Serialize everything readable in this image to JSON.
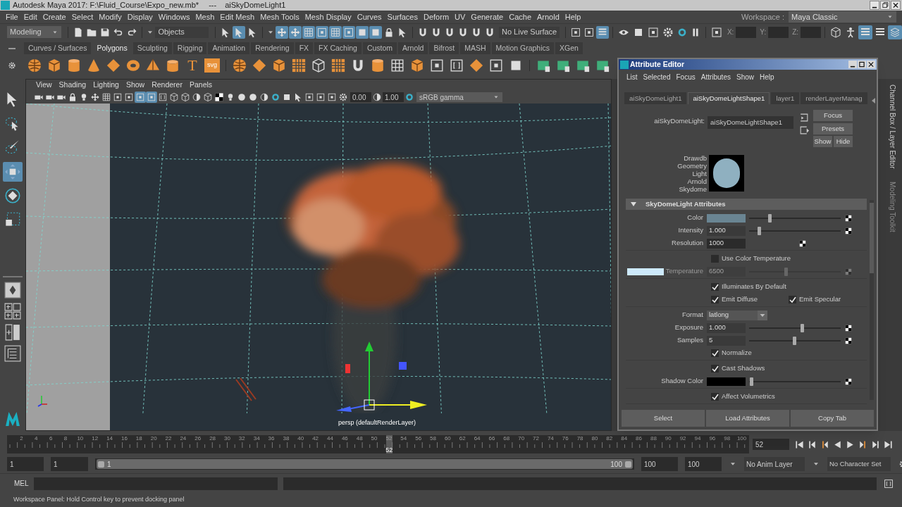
{
  "title_bar": {
    "title": "Autodesk Maya 2017: F:\\Fluid_Course\\Expo_new.mb*",
    "separator": "---",
    "object": "aiSkyDomeLight1"
  },
  "menu_bar": [
    "File",
    "Edit",
    "Create",
    "Select",
    "Modify",
    "Display",
    "Windows",
    "Mesh",
    "Edit Mesh",
    "Mesh Tools",
    "Mesh Display",
    "Curves",
    "Surfaces",
    "Deform",
    "UV",
    "Generate",
    "Cache",
    "Arnold",
    "Help"
  ],
  "workspace": {
    "label": "Workspace :",
    "value": "Maya Classic"
  },
  "status_line": {
    "mode": "Modeling",
    "selection_field": "Objects",
    "live_surface": "No Live Surface",
    "coordinates": [
      "X:",
      "Y:",
      "Z:"
    ]
  },
  "shelf": {
    "tabs": [
      {
        "label": "Curves / Surfaces",
        "selected": false
      },
      {
        "label": "Polygons",
        "selected": true
      },
      {
        "label": "Sculpting",
        "selected": false
      },
      {
        "label": "Rigging",
        "selected": false
      },
      {
        "label": "Animation",
        "selected": false
      },
      {
        "label": "Rendering",
        "selected": false
      },
      {
        "label": "FX",
        "selected": false
      },
      {
        "label": "FX Caching",
        "selected": false
      },
      {
        "label": "Custom",
        "selected": false
      },
      {
        "label": "Arnold",
        "selected": false
      },
      {
        "label": "Bifrost",
        "selected": false
      },
      {
        "label": "MASH",
        "selected": false
      },
      {
        "label": "Motion Graphics",
        "selected": false
      },
      {
        "label": "XGen",
        "selected": false
      }
    ],
    "text_icons": [
      "T",
      "svg"
    ]
  },
  "toolbox": {
    "tools": [
      {
        "kind": "select",
        "selected": false
      },
      {
        "kind": "lasso",
        "selected": false
      },
      {
        "kind": "paint",
        "selected": false
      },
      {
        "kind": "move",
        "selected": true
      },
      {
        "kind": "rotate",
        "selected": false
      },
      {
        "kind": "scale",
        "selected": false
      }
    ]
  },
  "viewport": {
    "menus": [
      "View",
      "Shading",
      "Lighting",
      "Show",
      "Renderer",
      "Panels"
    ],
    "exposure": "0.00",
    "gamma": "1.00",
    "color_space": "sRGB gamma",
    "camera_label": "persp (defaultRenderLayer)"
  },
  "attribute_editor": {
    "title": "Attribute Editor",
    "menus": [
      "List",
      "Selected",
      "Focus",
      "Attributes",
      "Show",
      "Help"
    ],
    "tabs": [
      {
        "label": "aiSkyDomeLight1",
        "selected": false
      },
      {
        "label": "aiSkyDomeLightShape1",
        "selected": true
      },
      {
        "label": "layer1",
        "selected": false
      },
      {
        "label": "renderLayerManag",
        "selected": false
      }
    ],
    "node_label": "aiSkyDomeLight:",
    "node_name": "aiSkyDomeLightShape1",
    "buttons": [
      "Focus",
      "Presets",
      "Show",
      "Hide"
    ],
    "swatch_caption": [
      "Drawdb",
      "Geometry",
      "Light",
      "Arnold",
      "Skydome"
    ],
    "section": {
      "title": "SkyDomeLight Attributes",
      "expanded": true,
      "groups": [
        [
          {
            "kind": "color",
            "label": "Color",
            "color": "#6a8593",
            "level": 0.22,
            "disabled": false
          },
          {
            "kind": "number",
            "label": "Intensity",
            "value": "1.000",
            "level": 0.11,
            "disabled": false
          },
          {
            "kind": "field",
            "label": "Resolution",
            "value": "1000",
            "disabled": false
          }
        ],
        [
          {
            "kind": "checkbox",
            "label": "Use Color Temperature",
            "checked": false,
            "disabled": false
          },
          {
            "kind": "number",
            "label": "Temperature",
            "value": "6500",
            "level": 0.4,
            "disabled": true,
            "color": "#cde9fb"
          }
        ],
        [
          {
            "kind": "checkbox",
            "label": "Illuminates By Default",
            "checked": true,
            "disabled": false
          },
          {
            "kind": "checkbox_pair",
            "items": [
              {
                "label": "Emit Diffuse",
                "checked": true
              },
              {
                "label": "Emit Specular",
                "checked": true
              }
            ],
            "disabled": false
          }
        ],
        [
          {
            "kind": "dropdown",
            "label": "Format",
            "value": "latlong",
            "disabled": false
          },
          {
            "kind": "number",
            "label": "Exposure",
            "value": "1.000",
            "level": 0.58,
            "disabled": false
          },
          {
            "kind": "number",
            "label": "Samples",
            "value": "5",
            "level": 0.49,
            "disabled": false
          },
          {
            "kind": "checkbox",
            "label": "Normalize",
            "checked": true,
            "disabled": false
          }
        ],
        [
          {
            "kind": "checkbox",
            "label": "Cast Shadows",
            "checked": true,
            "disabled": false
          },
          {
            "kind": "color",
            "label": "Shadow Color",
            "color": "#000000",
            "level": 0.02,
            "disabled": false
          }
        ],
        [
          {
            "kind": "checkbox",
            "label": "Affect Volumetrics",
            "checked": true,
            "disabled": false
          }
        ]
      ]
    },
    "footer_buttons": [
      "Select",
      "Load Attributes",
      "Copy Tab"
    ]
  },
  "side_tabs": [
    "Channel Box / Layer Editor",
    "Modeling Toolkit"
  ],
  "time_slider": {
    "ticks": [
      "2",
      "4",
      "6",
      "8",
      "10",
      "12",
      "14",
      "16",
      "18",
      "20",
      "22",
      "24",
      "26",
      "28",
      "30",
      "32",
      "34",
      "36",
      "38",
      "40",
      "42",
      "44",
      "46",
      "48",
      "50",
      "52",
      "54",
      "56",
      "58",
      "60",
      "62",
      "64",
      "66",
      "68",
      "70",
      "72",
      "74",
      "76",
      "78",
      "80",
      "82",
      "84",
      "86",
      "88",
      "90",
      "92",
      "94",
      "96",
      "98",
      "100"
    ],
    "playhead": {
      "label": "52",
      "level": 0.515
    },
    "current_frame": "52"
  },
  "range_slider": {
    "start": "1",
    "playback_start": "1",
    "range_start": "1",
    "range_end": "100",
    "playback_end": "100",
    "end": "100",
    "anim_layer": "No Anim Layer",
    "character_set": "No Character Set"
  },
  "command_line": {
    "language": "MEL"
  },
  "help_line": "Workspace Panel: Hold Control key to prevent docking panel"
}
